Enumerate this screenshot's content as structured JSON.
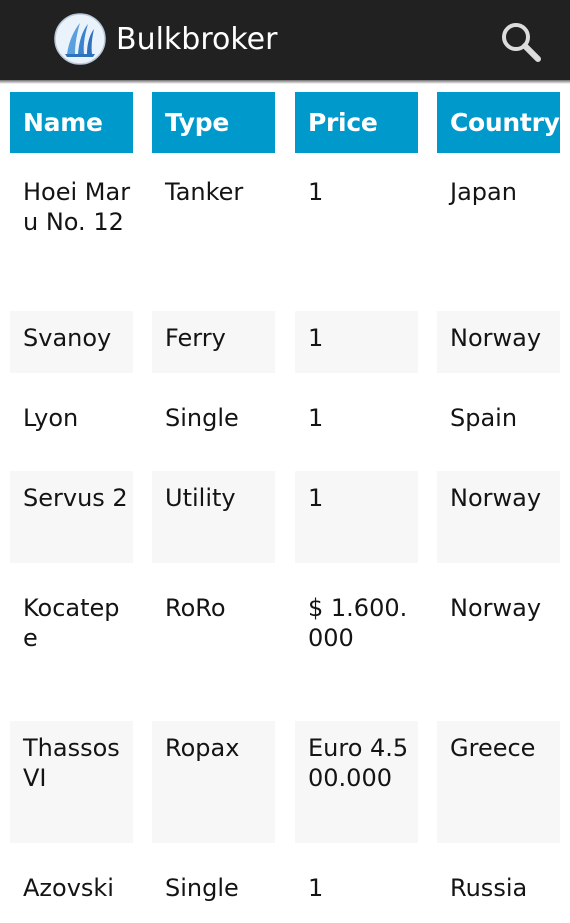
{
  "app": {
    "title": "Bulkbroker",
    "logo_icon": "sail-logo-icon",
    "search_icon": "search-icon"
  },
  "colors": {
    "action_bar": "#212121",
    "header_cell": "#0099cc",
    "header_text": "#ffffff",
    "shaded_row": "#f7f7f7"
  },
  "table": {
    "headers": [
      "Name",
      "Type",
      "Price",
      "Country"
    ],
    "rows": [
      {
        "name": "Hoei Maru No. 12",
        "type": "Tanker",
        "price": "1",
        "country": "Japan"
      },
      {
        "name": "Svanoy",
        "type": "Ferry",
        "price": "1",
        "country": "Norway"
      },
      {
        "name": "Lyon",
        "type": "Single",
        "price": "1",
        "country": "Spain"
      },
      {
        "name": "Servus 2",
        "type": "Utility",
        "price": "1",
        "country": "Norway"
      },
      {
        "name": "Kocatepe",
        "type": "RoRo",
        "price": "$ 1.600.000",
        "country": "Norway"
      },
      {
        "name": "Thassos VI",
        "type": "Ropax",
        "price": "Euro 4.500.000",
        "country": "Greece"
      },
      {
        "name": "Azovski",
        "type": "Single",
        "price": "1",
        "country": "Russia"
      }
    ]
  }
}
